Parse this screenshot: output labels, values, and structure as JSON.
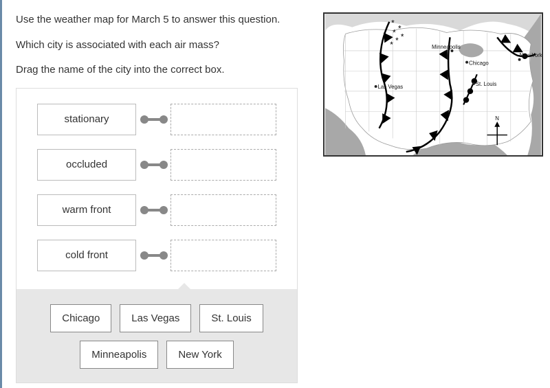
{
  "instructions": {
    "line1": "Use the weather map for March 5 to answer this question.",
    "line2": "Which city is associated with each air mass?",
    "line3": "Drag the name of the city into the correct box."
  },
  "categories": [
    {
      "label": "stationary"
    },
    {
      "label": "occluded"
    },
    {
      "label": "warm front"
    },
    {
      "label": "cold front"
    }
  ],
  "choices_row1": [
    {
      "label": "Chicago"
    },
    {
      "label": "Las Vegas"
    },
    {
      "label": "St. Louis"
    }
  ],
  "choices_row2": [
    {
      "label": "Minneapolis"
    },
    {
      "label": "New York"
    }
  ],
  "map": {
    "cities": {
      "minneapolis": "Minneapolis",
      "chicago": "Chicago",
      "new_york": "New York",
      "las_vegas": "Las Vegas",
      "st_louis": "St. Louis"
    },
    "compass": "N"
  }
}
